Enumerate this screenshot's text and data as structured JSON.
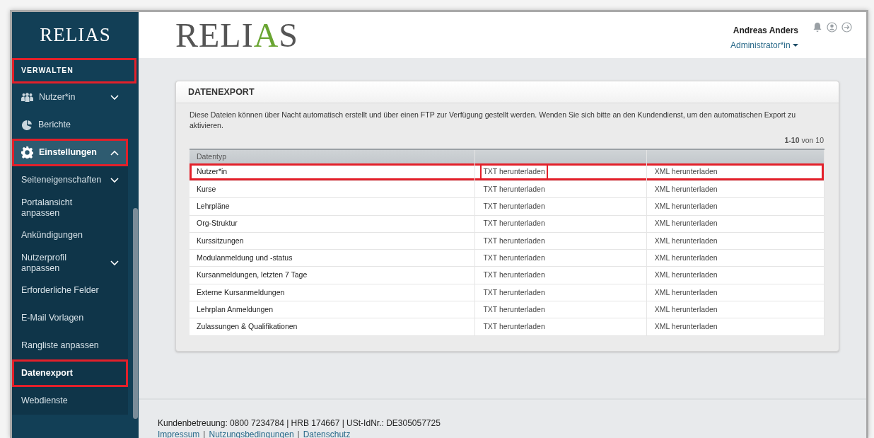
{
  "sidebar": {
    "logo": "RELIAS",
    "items": [
      {
        "kind": "section",
        "label": "VERWALTEN",
        "highlighted": true
      },
      {
        "kind": "main",
        "label": "Nutzer*in",
        "expanded": false,
        "highlighted": false
      },
      {
        "kind": "main",
        "label": "Berichte",
        "highlighted": false
      },
      {
        "kind": "main",
        "label": "Einstellungen",
        "expanded": true,
        "highlighted": true
      },
      {
        "kind": "sub",
        "label": "Seiteneigenschaften",
        "expanded": false,
        "selected": false,
        "highlighted": false
      },
      {
        "kind": "sub",
        "label": "Portalansicht anpassen",
        "selected": false,
        "highlighted": false
      },
      {
        "kind": "sub",
        "label": "Ankündigungen",
        "selected": false,
        "highlighted": false
      },
      {
        "kind": "sub",
        "label": "Nutzerprofil anpassen",
        "expanded": false,
        "selected": false,
        "highlighted": false
      },
      {
        "kind": "sub",
        "label": "Erforderliche Felder",
        "selected": false,
        "highlighted": false
      },
      {
        "kind": "sub",
        "label": "E-Mail Vorlagen",
        "selected": false,
        "highlighted": false
      },
      {
        "kind": "sub",
        "label": "Rangliste anpassen",
        "selected": false,
        "highlighted": false
      },
      {
        "kind": "sub",
        "label": "Datenexport",
        "selected": true,
        "highlighted": true
      },
      {
        "kind": "sub",
        "label": "Webdienste",
        "selected": false,
        "highlighted": false
      }
    ]
  },
  "header": {
    "logo": "RELIAS",
    "user_name": "Andreas Anders",
    "role": "Administrator*in"
  },
  "card": {
    "title": "DATENEXPORT",
    "description": "Diese Dateien können über Nacht automatisch erstellt und über einen FTP zur Verfügung gestellt werden. Wenden Sie sich bitte an den Kundendienst, um den automatischen Export zu aktivieren.",
    "pagination": "**1-10** von 10",
    "table": {
      "columns": [
        "Datentyp"
      ],
      "rows": [
        {
          "name": "Nutzer*in",
          "txt": "TXT herunterladen",
          "xml": "XML herunterladen",
          "highlighted": true,
          "txt_highlighted": true
        },
        {
          "name": "Kurse",
          "txt": "TXT herunterladen",
          "xml": "XML herunterladen",
          "highlighted": false,
          "txt_highlighted": false
        },
        {
          "name": "Lehrpläne",
          "txt": "TXT herunterladen",
          "xml": "XML herunterladen",
          "highlighted": false,
          "txt_highlighted": false
        },
        {
          "name": "Org-Struktur",
          "txt": "TXT herunterladen",
          "xml": "XML herunterladen",
          "highlighted": false,
          "txt_highlighted": false
        },
        {
          "name": "Kurssitzungen",
          "txt": "TXT herunterladen",
          "xml": "XML herunterladen",
          "highlighted": false,
          "txt_highlighted": false
        },
        {
          "name": "Modulanmeldung und -status",
          "txt": "TXT herunterladen",
          "xml": "XML herunterladen",
          "highlighted": false,
          "txt_highlighted": false
        },
        {
          "name": "Kursanmeldungen, letzten 7 Tage",
          "txt": "TXT herunterladen",
          "xml": "XML herunterladen",
          "highlighted": false,
          "txt_highlighted": false
        },
        {
          "name": "Externe Kursanmeldungen",
          "txt": "TXT herunterladen",
          "xml": "XML herunterladen",
          "highlighted": false,
          "txt_highlighted": false
        },
        {
          "name": "Lehrplan Anmeldungen",
          "txt": "TXT herunterladen",
          "xml": "XML herunterladen",
          "highlighted": false,
          "txt_highlighted": false
        },
        {
          "name": "Zulassungen & Qualifikationen",
          "txt": "TXT herunterladen",
          "xml": "XML herunterladen",
          "highlighted": false,
          "txt_highlighted": false
        }
      ]
    }
  },
  "footer": {
    "info": "Kundenbetreuung: 0800 7234784 | HRB 174667 | USt-IdNr.: DE305057725",
    "links": [
      "Impressum",
      "Nutzungsbedingungen",
      "Datenschutz"
    ],
    "separator": "|"
  }
}
